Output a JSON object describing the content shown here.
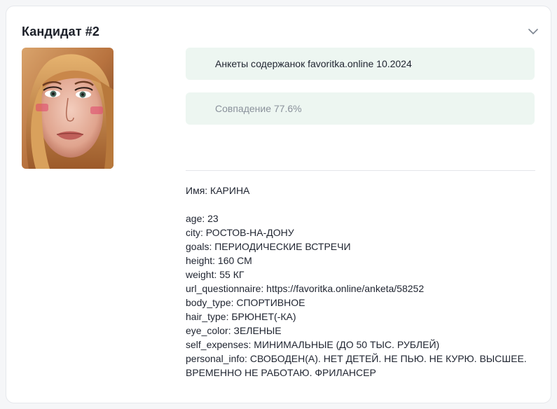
{
  "card": {
    "title": "Кандидат #2",
    "source": "Анкеты содержанок favoritka.online 10.2024",
    "match": "Совпадение 77.6%",
    "name_line": "Имя: КАРИНА",
    "fields": [
      "age: 23",
      "city: РОСТОВ-НА-ДОНУ",
      "goals: ПЕРИОДИЧЕСКИЕ ВСТРЕЧИ",
      "height: 160 СМ",
      "weight: 55 КГ",
      "url_questionnaire: https://favoritka.online/anketa/58252",
      "body_type: СПОРТИВНОЕ",
      "hair_type: БРЮНЕТ(-КА)",
      "eye_color: ЗЕЛЕНЫЕ",
      "self_expenses: МИНИМАЛЬНЫЕ (ДО 50 ТЫС. РУБЛЕЙ)",
      "personal_info: СВОБОДЕН(А). НЕТ ДЕТЕЙ. НЕ ПЬЮ. НЕ КУРЮ. ВЫСШЕЕ.",
      "ВРЕМЕННО НЕ РАБОТАЮ. ФРИЛАНСЕР"
    ]
  },
  "icons": {
    "collapse": "chevron-down-icon"
  }
}
